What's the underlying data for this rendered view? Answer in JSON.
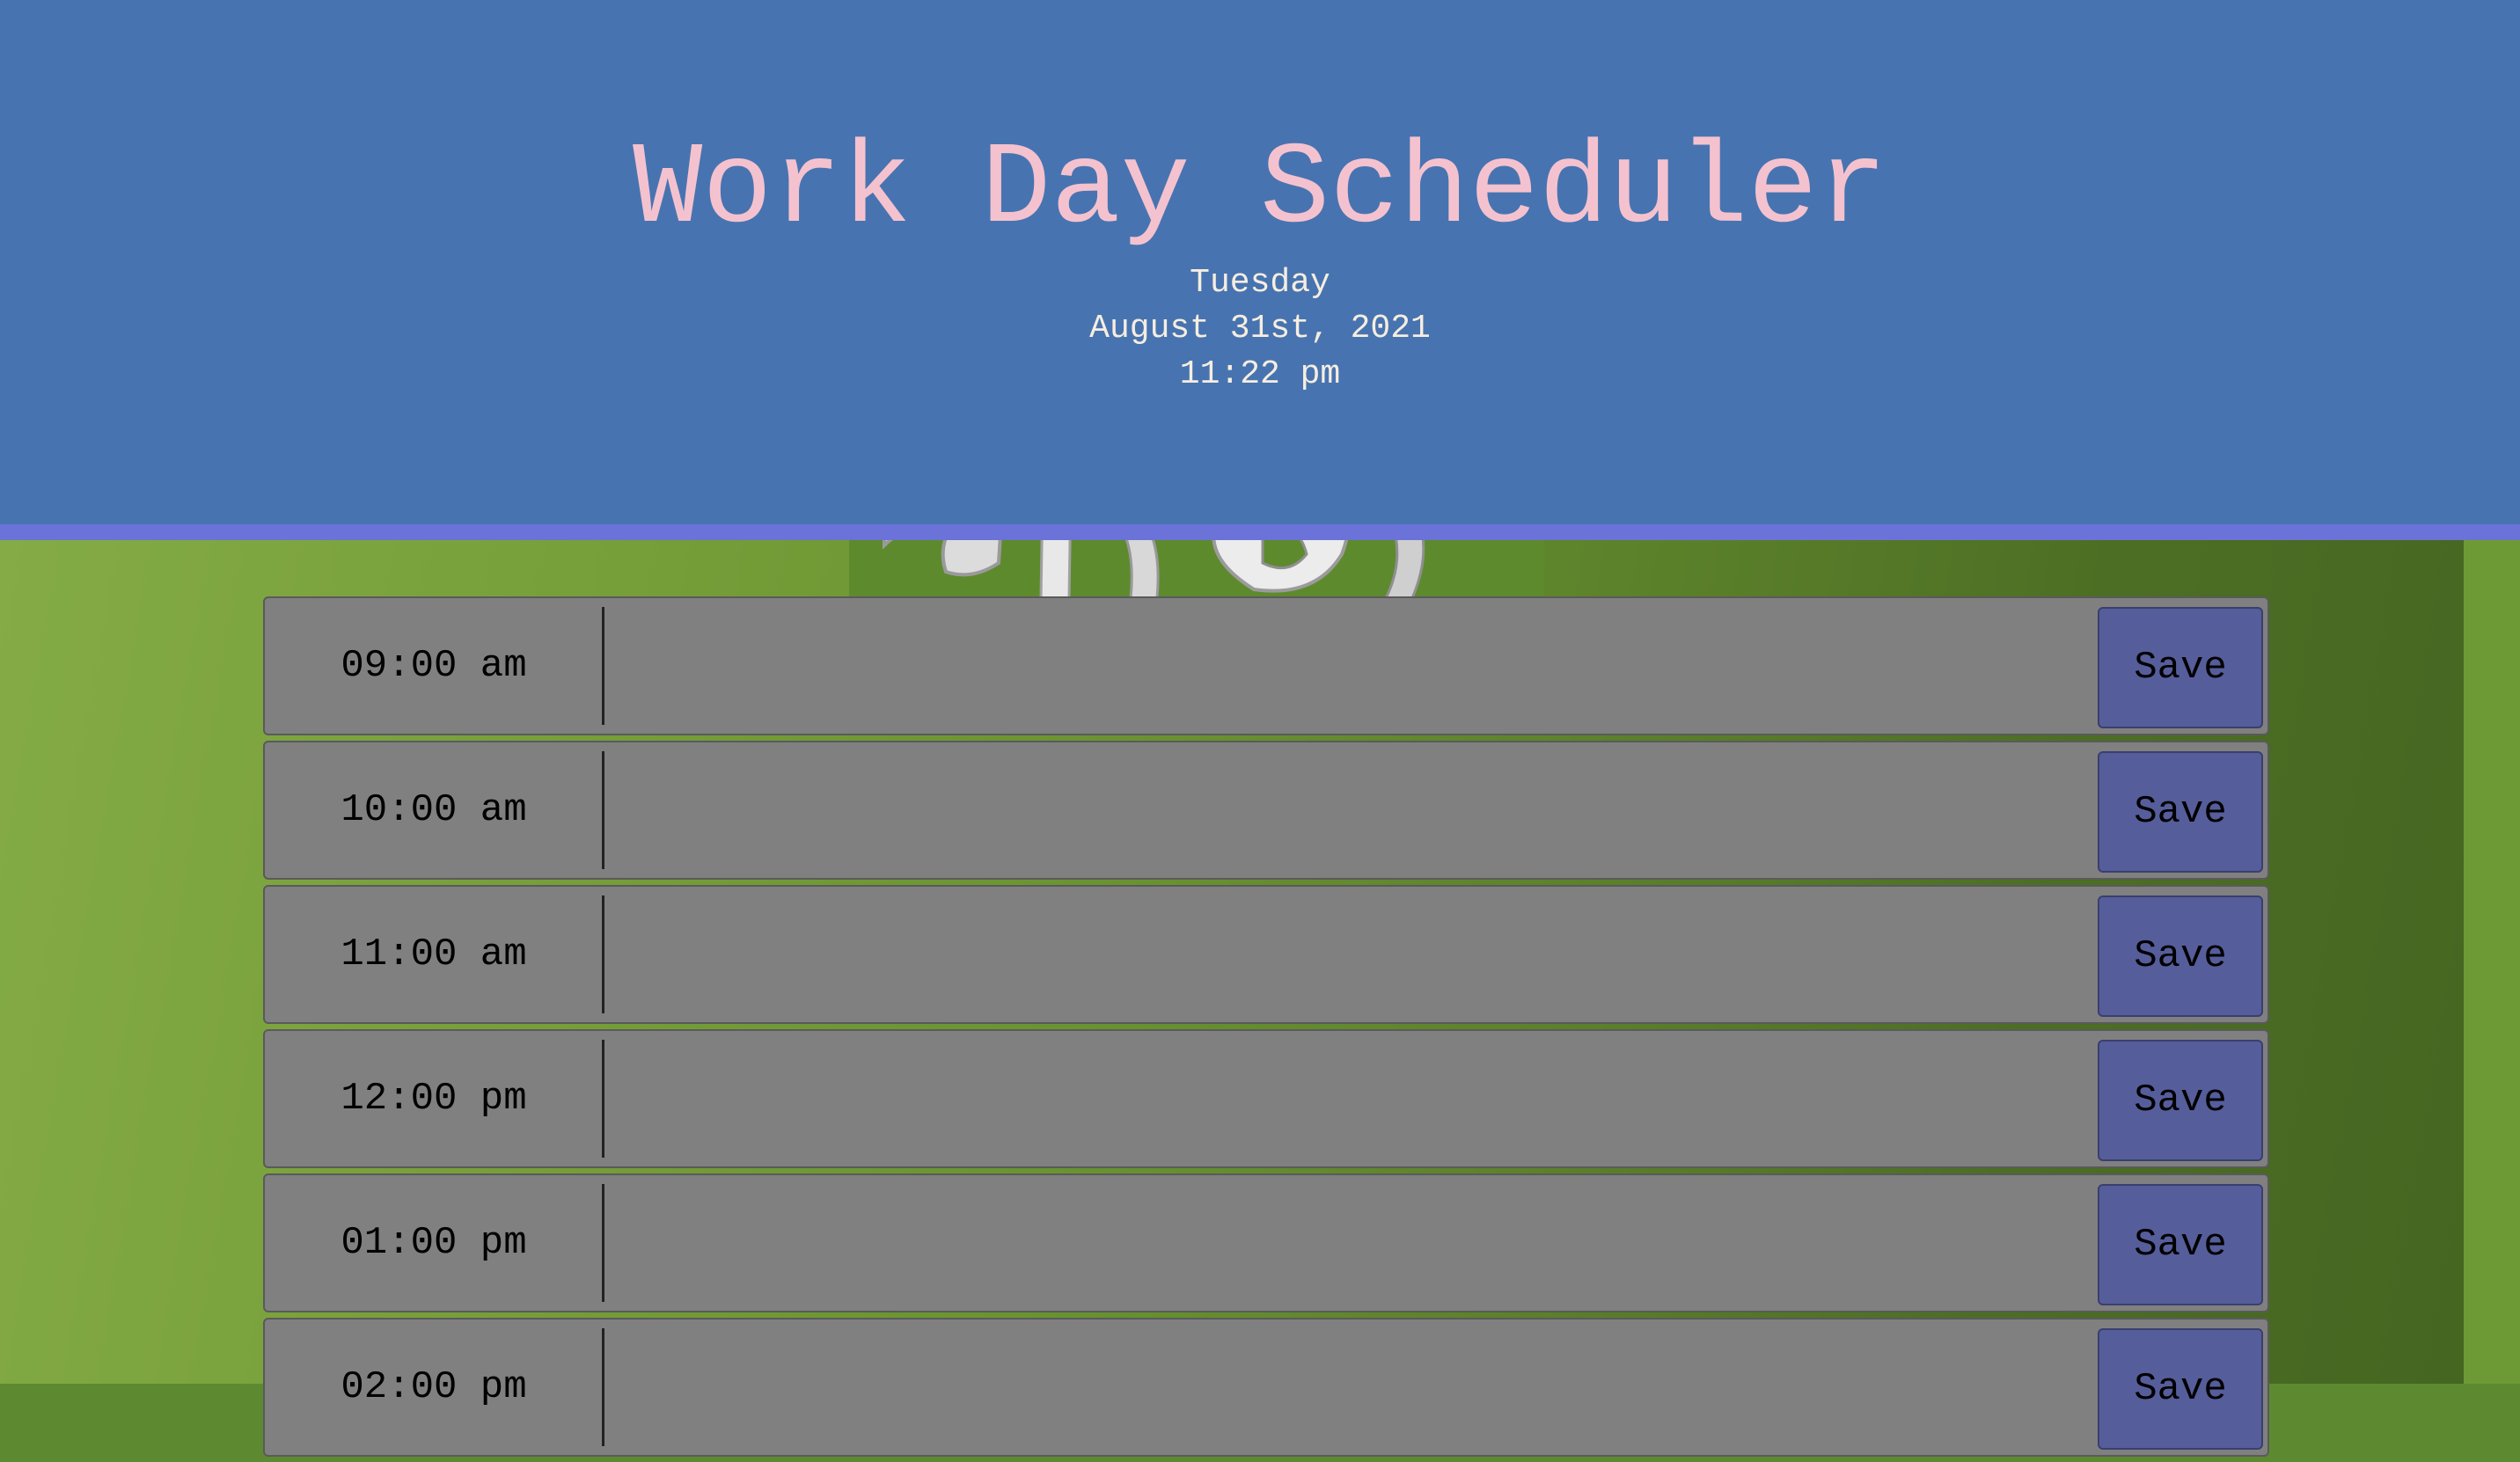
{
  "header": {
    "title": "Work Day Scheduler",
    "day": "Tuesday",
    "date": "August 31st, 2021",
    "time": "11:22 pm"
  },
  "colors": {
    "header_bg": "#4774b0",
    "header_rule": "#6b72d8",
    "title": "#f4c2cf",
    "row_bg": "#808080",
    "save_bg": "#565d9b"
  },
  "timeblocks": [
    {
      "hour": "09:00 am",
      "save_label": "Save",
      "description": ""
    },
    {
      "hour": "10:00 am",
      "save_label": "Save",
      "description": ""
    },
    {
      "hour": "11:00 am",
      "save_label": "Save",
      "description": ""
    },
    {
      "hour": "12:00 pm",
      "save_label": "Save",
      "description": ""
    },
    {
      "hour": "01:00 pm",
      "save_label": "Save",
      "description": ""
    },
    {
      "hour": "02:00 pm",
      "save_label": "Save",
      "description": ""
    }
  ]
}
